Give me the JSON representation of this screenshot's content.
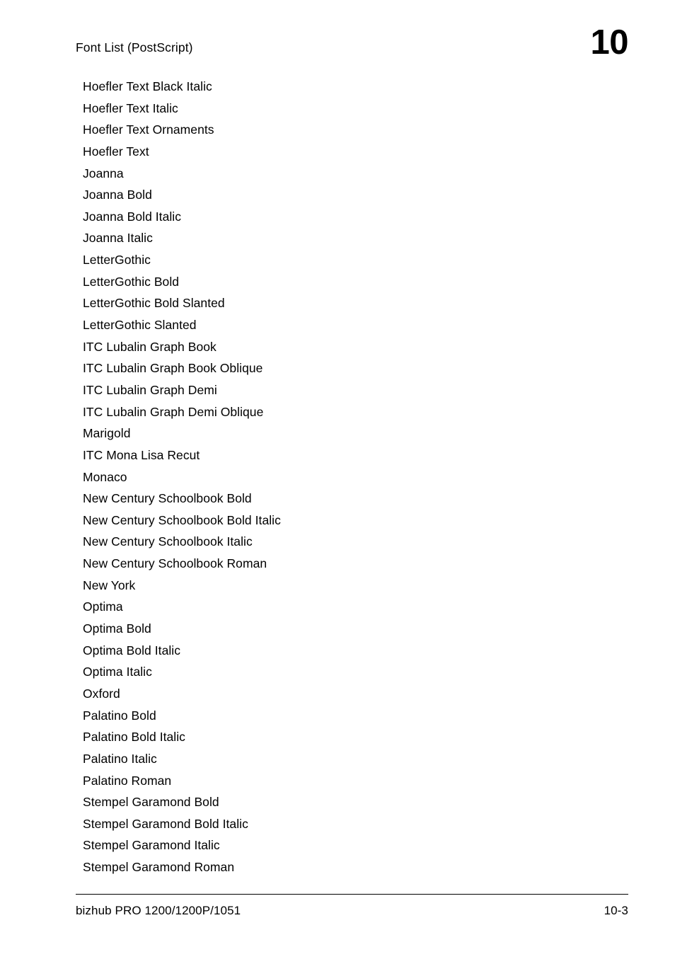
{
  "document": {
    "background_color": "#ffffff",
    "text_color": "#000000"
  },
  "header": {
    "title": "Font List (PostScript)",
    "chapter_number": "10"
  },
  "main": {
    "font_list": [
      "Hoefler Text Black Italic",
      "Hoefler Text Italic",
      "Hoefler Text Ornaments",
      "Hoefler Text",
      "Joanna",
      "Joanna Bold",
      "Joanna Bold Italic",
      "Joanna Italic",
      "LetterGothic",
      "LetterGothic Bold",
      "LetterGothic Bold Slanted",
      "LetterGothic Slanted",
      "ITC Lubalin Graph Book",
      "ITC Lubalin Graph Book Oblique",
      "ITC Lubalin Graph Demi",
      "ITC Lubalin Graph Demi Oblique",
      "Marigold",
      "ITC Mona Lisa Recut",
      "Monaco",
      "New Century Schoolbook Bold",
      "New Century Schoolbook Bold Italic",
      "New Century Schoolbook Italic",
      "New Century Schoolbook Roman",
      "New York",
      "Optima",
      "Optima Bold",
      "Optima Bold Italic",
      "Optima Italic",
      "Oxford",
      "Palatino Bold",
      "Palatino Bold Italic",
      "Palatino Italic",
      "Palatino Roman",
      "Stempel Garamond Bold",
      "Stempel Garamond Bold Italic",
      "Stempel Garamond Italic",
      "Stempel Garamond Roman"
    ]
  },
  "footer": {
    "product": "bizhub PRO 1200/1200P/1051",
    "page_number": "10-3"
  }
}
